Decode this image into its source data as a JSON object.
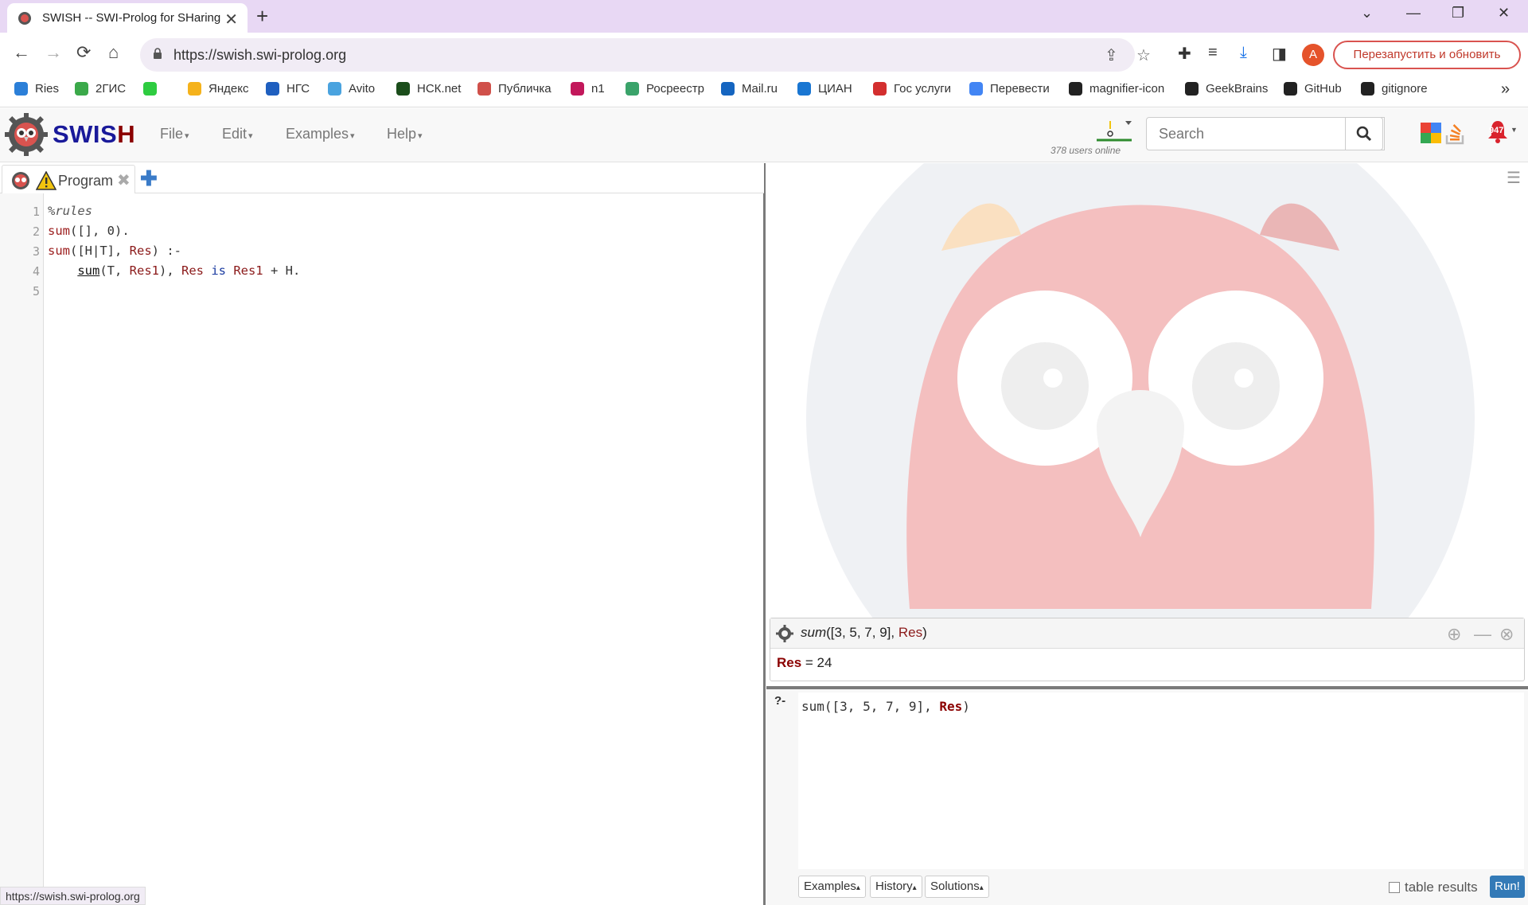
{
  "browser": {
    "tab_title": "SWISH -- SWI-Prolog for SHaring",
    "tab_close": "✕",
    "new_tab": "+",
    "window_controls": {
      "chevron": "⌄",
      "minimize": "—",
      "restore": "❐",
      "close": "✕"
    },
    "nav": {
      "back": "←",
      "forward": "→",
      "reload": "⟳",
      "home": "⌂"
    },
    "url": "https://swish.swi-prolog.org",
    "relaunch_button": "Перезапустить и обновить",
    "avatar_letter": "A",
    "bookmarks": [
      {
        "label": "Ries",
        "color": "#2b7fd8"
      },
      {
        "label": "2ГИС",
        "color": "#3ba94a"
      },
      {
        "label": "",
        "color": "#2ecc40"
      },
      {
        "label": "Яндекс",
        "color": "#f5b21b"
      },
      {
        "label": "НГС",
        "color": "#1f5fbf"
      },
      {
        "label": "Avito",
        "color": "#4aa3df"
      },
      {
        "label": "НСК.net",
        "color": "#1b4d1b"
      },
      {
        "label": "Публичка",
        "color": "#d0504a"
      },
      {
        "label": "n1",
        "color": "#c2185b"
      },
      {
        "label": "Росреестр",
        "color": "#3aa36a"
      },
      {
        "label": "Mail.ru",
        "color": "#1565c0"
      },
      {
        "label": "ЦИАН",
        "color": "#1976d2"
      },
      {
        "label": "Гос услуги",
        "color": "#d32f2f"
      },
      {
        "label": "Перевести",
        "color": "#4285f4"
      },
      {
        "label": "magnifier-icon",
        "color": "#222222"
      },
      {
        "label": "GeekBrains",
        "color": "#222222"
      },
      {
        "label": "GitHub",
        "color": "#222222"
      },
      {
        "label": "gitignore",
        "color": "#222222"
      }
    ],
    "bookmarks_more": "»",
    "status_url": "https://swish.swi-prolog.org"
  },
  "swish": {
    "title_main": "SWIS",
    "title_h": "H",
    "menus": [
      {
        "label": "File"
      },
      {
        "label": "Edit"
      },
      {
        "label": "Examples"
      },
      {
        "label": "Help"
      }
    ],
    "menu_caret": "▾",
    "users_online": "378 users online",
    "search_placeholder": "Search",
    "notifications_count": "947"
  },
  "editor": {
    "tab_label": "Program",
    "tab_close": "✖",
    "add_tab": "✚",
    "line_numbers": [
      "1",
      "2",
      "3",
      "4",
      "5"
    ],
    "lines": {
      "l1": "%rules",
      "l2_head": "sum",
      "l2_rest": "([], 0).",
      "l3_head": "sum",
      "l3_a": "([H|T], ",
      "l3_var": "Res",
      "l3_b": ") :-",
      "l4_indent": "    ",
      "l4_call": "sum",
      "l4_a": "(T, ",
      "l4_var1": "Res1",
      "l4_b": "), ",
      "l4_var2": "Res",
      "l4_is": " is ",
      "l4_var3": "Res1",
      "l4_c": " + H."
    }
  },
  "answer": {
    "query_fn": "sum",
    "query_args": "([3, 5, 7, 9], ",
    "query_var": "Res",
    "query_close": ")",
    "result_var": "Res",
    "result_eq": " = 24",
    "controls": {
      "download": "⊕",
      "minimize": "—",
      "close": "⊗"
    }
  },
  "query": {
    "prompt": "?-",
    "text_a": "sum([3, 5, 7, 9], ",
    "text_var": "Res",
    "text_b": ")",
    "buttons": {
      "examples": "Examples",
      "history": "History",
      "solutions": "Solutions"
    },
    "btn_caret": "▴",
    "table_results": "table results",
    "run": "Run!"
  }
}
